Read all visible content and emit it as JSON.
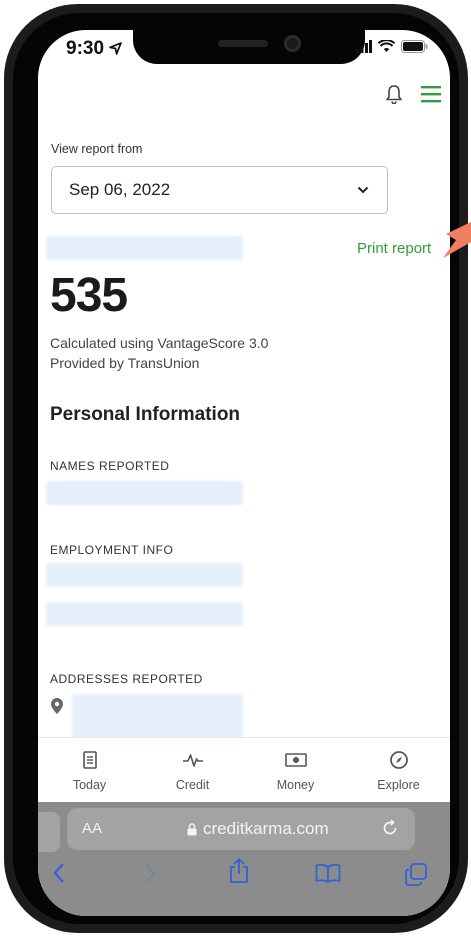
{
  "status_bar": {
    "time": "9:30"
  },
  "report": {
    "view_label": "View report from",
    "date_value": "Sep 06, 2022",
    "print_label": "Print report",
    "score": "535",
    "calc_line1": "Calculated using VantageScore 3.0",
    "calc_line2": "Provided by TransUnion"
  },
  "personal": {
    "title": "Personal Information",
    "names_label": "NAMES REPORTED",
    "employment_label": "EMPLOYMENT INFO",
    "addresses_label": "ADDRESSES REPORTED"
  },
  "bottom_nav": [
    {
      "label": "Today",
      "icon": "document-icon"
    },
    {
      "label": "Credit",
      "icon": "pulse-icon"
    },
    {
      "label": "Money",
      "icon": "cash-icon"
    },
    {
      "label": "Explore",
      "icon": "compass-icon"
    }
  ],
  "browser": {
    "text_size_label": "AA",
    "url": "creditkarma.com"
  },
  "colors": {
    "accent_green": "#2e9f3a",
    "annotation_arrow": "#f07f62",
    "redaction": "#e6f0fb"
  }
}
